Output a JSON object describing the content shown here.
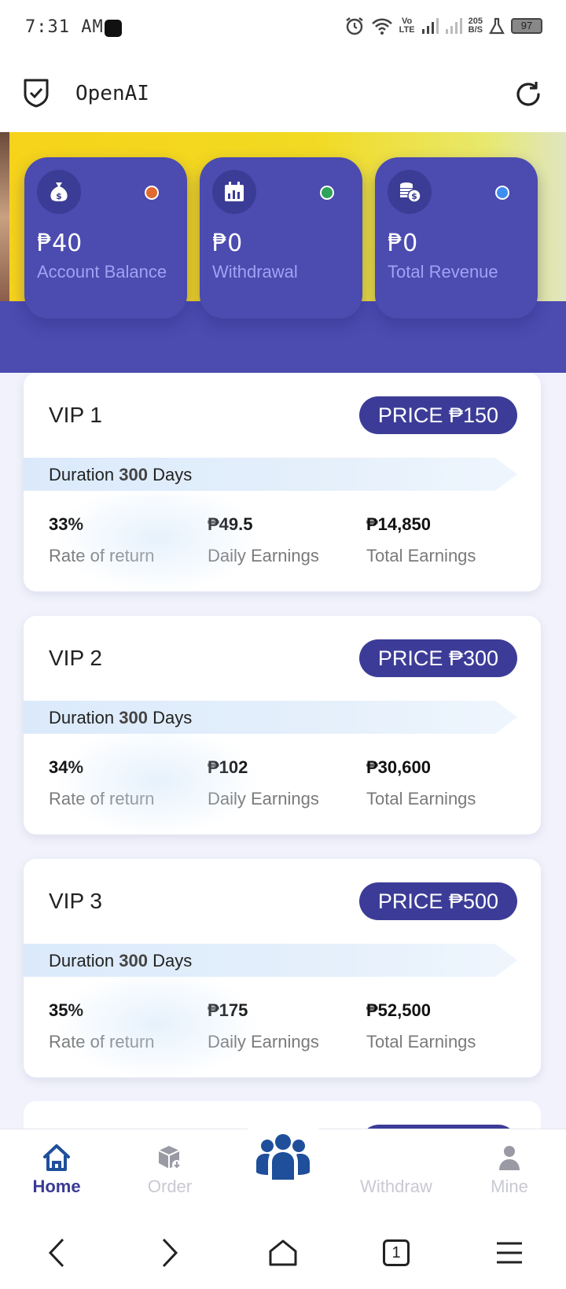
{
  "status_bar": {
    "time": "7:31 AM",
    "network_label_top": "Vo",
    "network_label_bottom": "LTE",
    "speed_value": "205",
    "speed_unit": "B/S",
    "battery": "97",
    "icons": [
      "alarm-icon",
      "wifi-icon",
      "signal-icon",
      "signal-weak-icon",
      "lab-icon",
      "battery-icon"
    ]
  },
  "app_bar": {
    "title": "OpenAI",
    "logo_icon": "shield-check-icon",
    "refresh_icon": "refresh-icon"
  },
  "stats": [
    {
      "value": "₱40",
      "label": "Account Balance",
      "icon": "money-bag-icon",
      "dot_color": "#e06a2f"
    },
    {
      "value": "₱0",
      "label": "Withdrawal",
      "icon": "calendar-chart-icon",
      "dot_color": "#2fa35a"
    },
    {
      "value": "₱0",
      "label": "Total Revenue",
      "icon": "coins-icon",
      "dot_color": "#3d8ef0"
    }
  ],
  "vip_plans": [
    {
      "title": "VIP 1",
      "price": "PRICE ₱150",
      "duration_prefix": "Duration",
      "duration_days": "300",
      "duration_suffix": "Days",
      "rate": "33%",
      "rate_label": "Rate of return",
      "daily": "₱49.5",
      "daily_label": "Daily Earnings",
      "total": "₱14,850",
      "total_label": "Total Earnings"
    },
    {
      "title": "VIP 2",
      "price": "PRICE ₱300",
      "duration_prefix": "Duration",
      "duration_days": "300",
      "duration_suffix": "Days",
      "rate": "34%",
      "rate_label": "Rate of return",
      "daily": "₱102",
      "daily_label": "Daily Earnings",
      "total": "₱30,600",
      "total_label": "Total Earnings"
    },
    {
      "title": "VIP 3",
      "price": "PRICE ₱500",
      "duration_prefix": "Duration",
      "duration_days": "300",
      "duration_suffix": "Days",
      "rate": "35%",
      "rate_label": "Rate of return",
      "daily": "₱175",
      "daily_label": "Daily Earnings",
      "total": "₱52,500",
      "total_label": "Total Earnings"
    }
  ],
  "bottom_nav": {
    "items": [
      {
        "label": "Home",
        "icon": "home-icon",
        "active": true
      },
      {
        "label": "Order",
        "icon": "package-icon",
        "active": false
      },
      {
        "label": "",
        "icon": "team-icon",
        "active": false
      },
      {
        "label": "Withdraw",
        "icon": "withdraw-icon",
        "active": false
      },
      {
        "label": "Mine",
        "icon": "user-icon",
        "active": false
      }
    ],
    "active_color": "#3a3a95",
    "center_color": "#1f4f9a"
  },
  "system_nav": {
    "tab_count": "1",
    "icons": [
      "back-icon",
      "forward-icon",
      "home-outline-icon",
      "tabs-icon",
      "menu-icon"
    ]
  }
}
